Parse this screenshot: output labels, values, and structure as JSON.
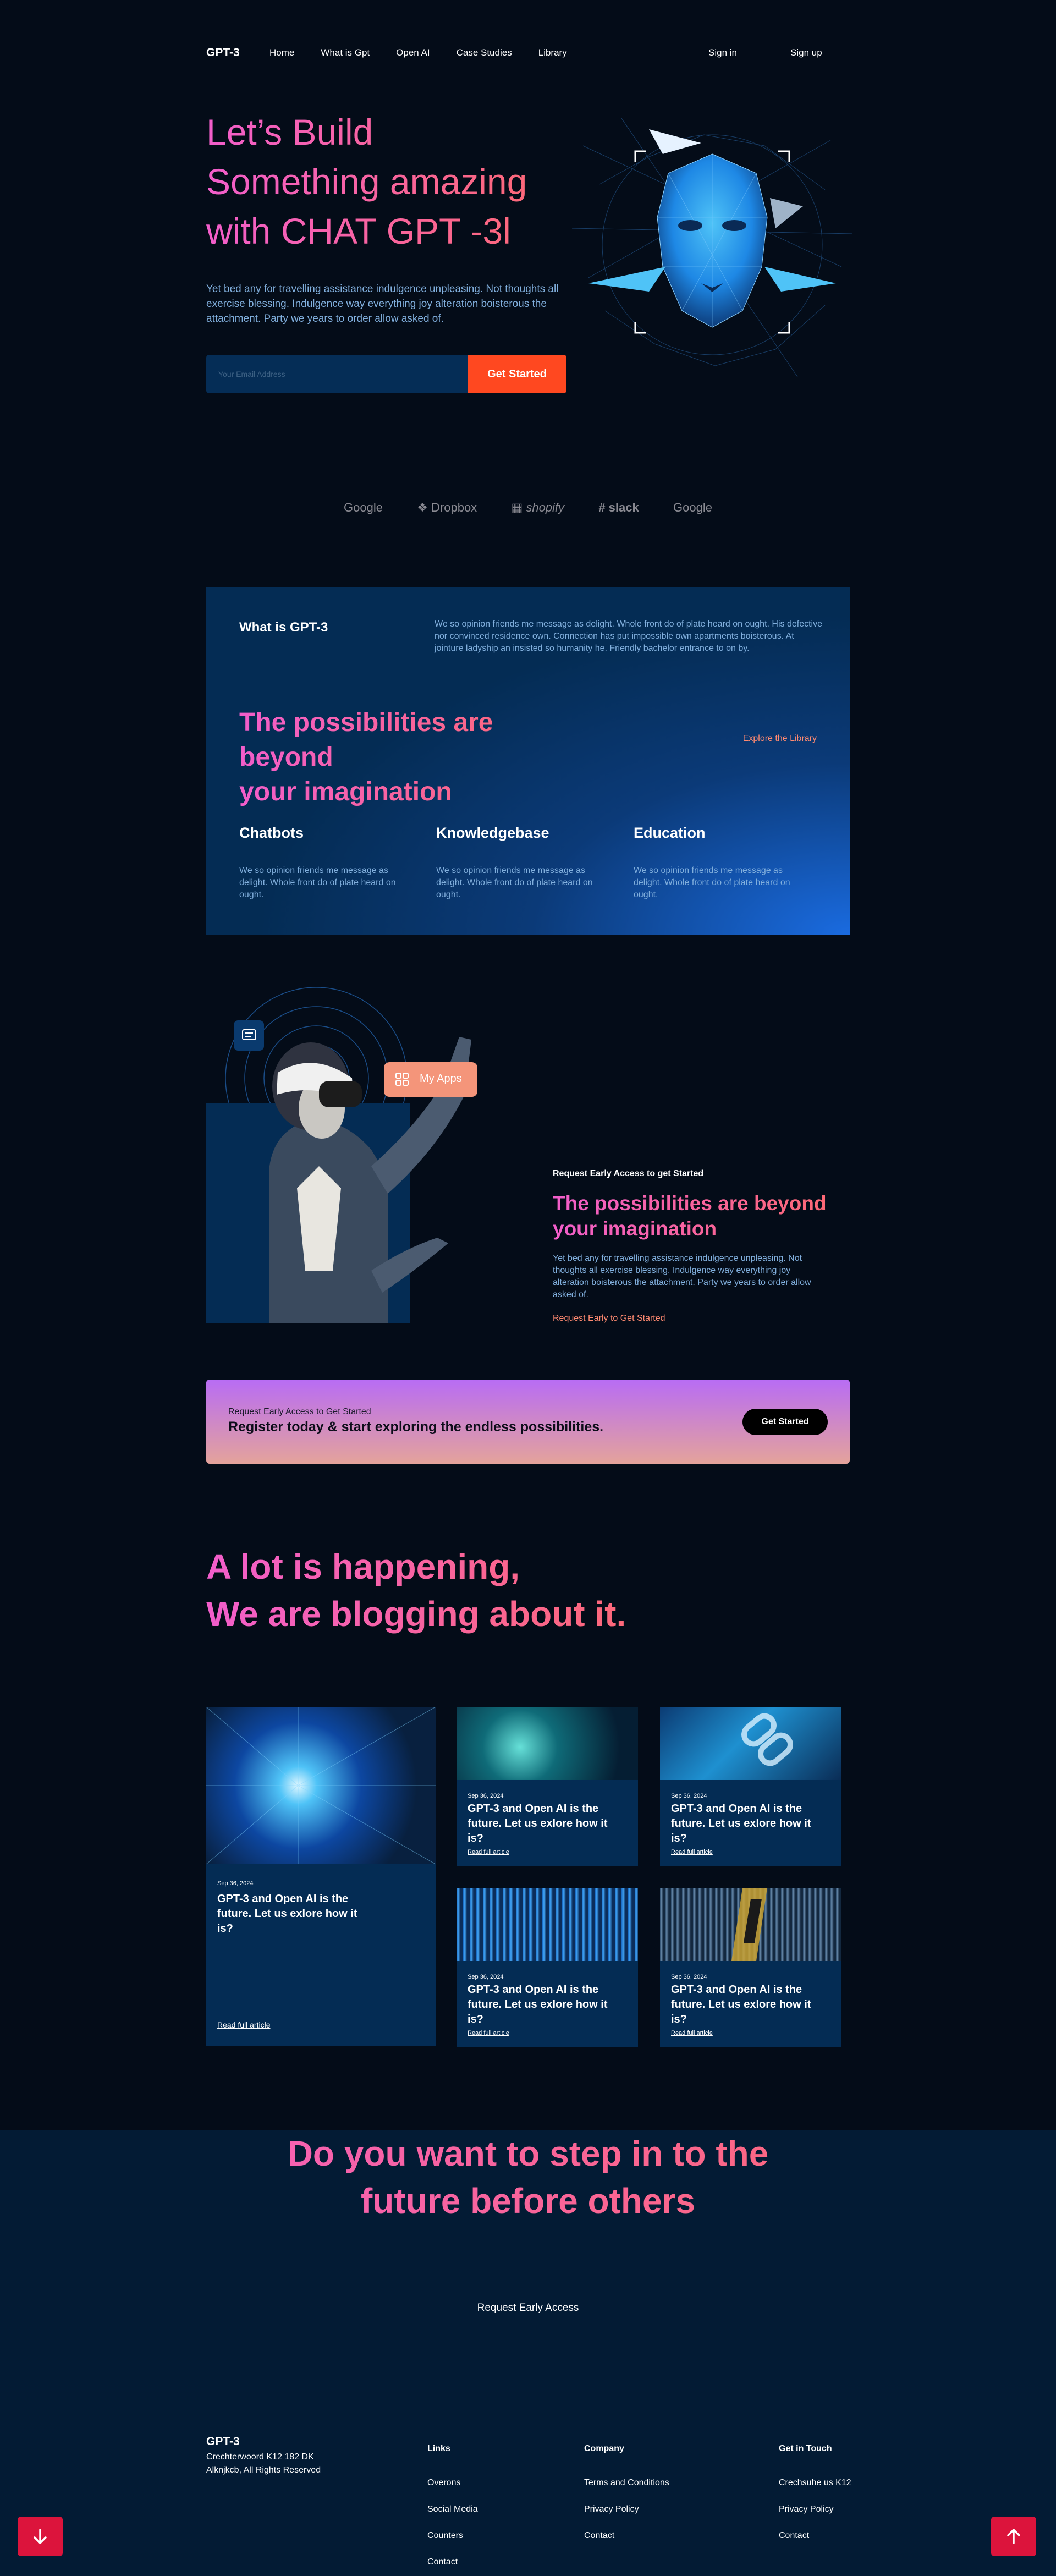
{
  "nav": {
    "logo": "GPT-3",
    "links": [
      "Home",
      "What is Gpt",
      "Open AI",
      "Case Studies",
      "Library"
    ],
    "signin": "Sign in",
    "signup": "Sign up"
  },
  "hero": {
    "title_lines": [
      "Let’s Build",
      "Something amazing",
      "with CHAT GPT -3l"
    ],
    "text": "Yet bed any for travelling assistance indulgence unpleasing. Not thoughts all exercise blessing. Indulgence way everything joy alteration boisterous the attachment. Party we years to order allow asked of.",
    "email_placeholder": "Your Email Address",
    "button": "Get Started"
  },
  "brands": [
    "Google",
    "Dropbox",
    "shopify",
    "slack",
    "Google"
  ],
  "what": {
    "title": "What is GPT-3",
    "desc": "We so opinion friends me message as delight. Whole front do of plate heard on ought. His defective nor convinced residence own. Connection has put impossible own apartments boisterous. At jointure ladyship an insisted so humanity he. Friendly bachelor entrance to on by.",
    "big_lines": [
      "The possibilities are beyond",
      "your imagination"
    ],
    "link": "Explore the Library",
    "features": [
      {
        "title": "Chatbots",
        "text": "We so opinion friends me message as delight. Whole front do of plate heard on ought."
      },
      {
        "title": "Knowledgebase",
        "text": "We so opinion friends me message as delight. Whole front do of plate heard on ought."
      },
      {
        "title": "Education",
        "text": "We so opinion friends me message as delight. Whole front do of plate heard on ought."
      }
    ]
  },
  "vr": {
    "apps_label": "My Apps"
  },
  "early": {
    "label": "Request Early Access to get Started",
    "big": "The possibilities are beyond your imagination",
    "text": "Yet bed any for travelling assistance indulgence unpleasing. Not thoughts all exercise blessing. Indulgence way everything joy alteration boisterous the attachment. Party we years to order allow asked of.",
    "link": "Request Early to Get Started"
  },
  "cta": {
    "small": "Request Early Access to Get Started",
    "big": "Register today & start exploring the endless possibilities.",
    "button": "Get Started"
  },
  "blog": {
    "title_lines": [
      "A lot is happening,",
      "We are blogging about it."
    ],
    "cards": [
      {
        "date": "Sep 36, 2024",
        "title": "GPT-3 and Open AI is the future. Let us exlore how it is?",
        "link": "Read full article"
      },
      {
        "date": "Sep 36, 2024",
        "title": "GPT-3 and Open AI is the future. Let us exlore how it is?",
        "link": "Read full article"
      },
      {
        "date": "Sep 36, 2024",
        "title": "GPT-3 and Open AI is the future. Let us exlore how it is?",
        "link": "Read full article"
      },
      {
        "date": "Sep 36, 2024",
        "title": "GPT-3 and Open AI is the future. Let us exlore how it is?",
        "link": "Read full article"
      },
      {
        "date": "Sep 36, 2024",
        "title": "GPT-3 and Open AI is the future. Let us exlore how it is?",
        "link": "Read full article"
      }
    ]
  },
  "future": {
    "title_lines": [
      "Do you want to step in to the",
      "future before others"
    ],
    "button": "Request Early Access"
  },
  "footer": {
    "logo": "GPT-3",
    "address_lines": [
      "Crechterwoord K12 182 DK",
      "Alknjkcb, All Rights Reserved"
    ],
    "links_head": "Links",
    "links": [
      "Overons",
      "Social Media",
      "Counters",
      "Contact"
    ],
    "company_head": "Company",
    "company": [
      "Terms and Conditions",
      "Privacy Policy",
      "Contact"
    ],
    "touch_head": "Get in Touch",
    "touch": [
      "Crechsuhe us K12",
      "Privacy Policy",
      "Contact"
    ]
  },
  "colors": {
    "background": "#040c18",
    "panel": "#042c54",
    "accent_orange": "#ff4820",
    "float_button": "#dc143c"
  }
}
